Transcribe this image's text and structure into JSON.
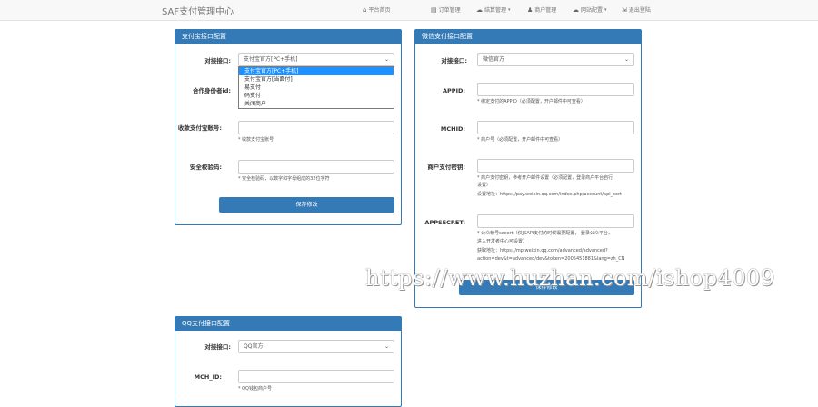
{
  "navbar": {
    "brand": "SAF支付管理中心",
    "items": [
      {
        "icon": "home-icon",
        "glyph": "⌂",
        "label": "平台首页"
      },
      {
        "icon": "cart-icon",
        "glyph": "▤",
        "label": "订单管理"
      },
      {
        "icon": "cloud-icon",
        "glyph": "☁",
        "label": "结算管理"
      },
      {
        "icon": "user-icon",
        "glyph": "♟",
        "label": "商户管理"
      },
      {
        "icon": "cloud-icon",
        "glyph": "☁",
        "label": "网站配置"
      },
      {
        "icon": "logout-icon",
        "glyph": "⇲",
        "label": "退出登陆"
      }
    ]
  },
  "alipay": {
    "title": "支付宝接口配置",
    "interface_label": "对接接口:",
    "interface_value": "支付宝官方[PC+手机]",
    "options": [
      "支付宝官方[PC+手机]",
      "支付宝官方[当面付]",
      "易支付",
      "码支付",
      "关闭商户"
    ],
    "partner_label": "合作身份者id:",
    "account_label": "收款支付宝账号:",
    "account_help": "* 收款支付宝账号",
    "key_label": "安全校验码:",
    "key_help": "* 安全检验码，以数字和字母组成的32位字符",
    "save_label": "保存修改"
  },
  "wechat": {
    "title": "微信支付接口配置",
    "interface_label": "对接接口:",
    "interface_value": "微信官方",
    "appid_label": "APPID:",
    "appid_help": "* 绑定支付的APPID（必须配置，开户邮件中可查看）",
    "mchid_label": "MCHID:",
    "mchid_help": "* 商户号（必须配置，开户邮件中可查看）",
    "key_label": "商户支付密钥:",
    "key_help_1": "* 商户支付密钥，参考开户邮件设置（必须配置，登录商户平台自行",
    "key_help_2": "设置）",
    "key_help_3": "设置地址：https://pay.weixin.qq.com/index.php/account/api_cert",
    "secret_label": "APPSECRET:",
    "secret_help_1": "* 公众帐号secert（仅JSAPI支付的时候需要配置， 登录公众平台，",
    "secret_help_2": "进入开发者中心可设置）",
    "secret_help_3": "获取地址：https://mp.weixin.qq.com/advanced/advanced?",
    "secret_help_4": "action=dev&t=advanced/dev&token=2005451881&lang=zh_CN",
    "save_label": "保存修改"
  },
  "qq": {
    "title": "QQ支付接口配置",
    "interface_label": "对接接口:",
    "interface_value": "QQ官方",
    "mch_label": "MCH_ID:",
    "mch_help": "* QQ钱包商户号"
  },
  "watermark": "https://www.huzhan.com/ishop4009"
}
